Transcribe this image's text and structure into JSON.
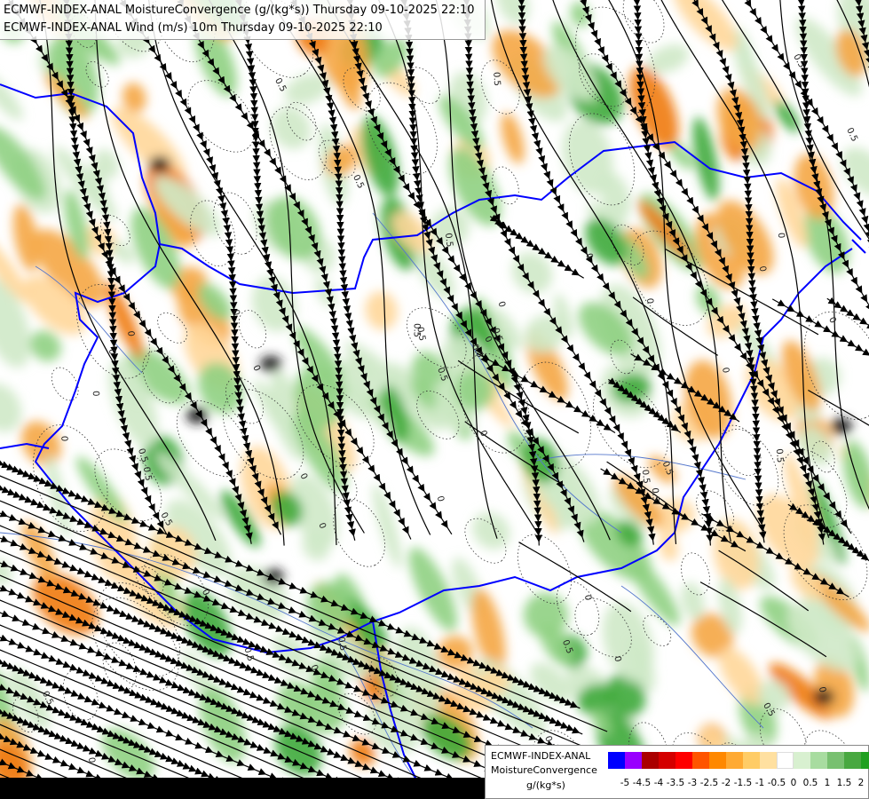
{
  "titles": {
    "line1": "ECMWF-INDEX-ANAL MoistureConvergence (g/(kg*s)) Thursday 09-10-2025 22:10",
    "line2": "ECMWF-INDEX-ANAL Wind (m/s) 10m Thursday 09-10-2025 22:10"
  },
  "legend": {
    "title1": "ECMWF-INDEX-ANAL",
    "title2": "MoistureConvergence",
    "unit": "g/(kg*s)",
    "colors": [
      "#0000ff",
      "#9900ff",
      "#aa0000",
      "#d40000",
      "#ff0000",
      "#ff5500",
      "#ff8800",
      "#ffaa33",
      "#ffcc66",
      "#ffe0a0",
      "#ffffff",
      "#d8f0d0",
      "#a8dca0",
      "#78c070",
      "#48a840",
      "#20a020"
    ],
    "ticks": [
      "-5",
      "-4.5",
      "-4",
      "-3.5",
      "-3",
      "-2.5",
      "-2",
      "-1.5",
      "-1",
      "-0.5",
      "0",
      "0.5",
      "1",
      "1.5",
      "2"
    ]
  },
  "map": {
    "contour_labels": [
      "0",
      "0.5",
      "-0.5"
    ],
    "colors": {
      "border": "#0000ff",
      "river": "#5577cc",
      "streamline": "#000000",
      "convergence_light": "#cfe9c8",
      "convergence_mid": "#8fd082",
      "convergence_strong": "#3faa3a",
      "divergence_light": "#ffd79a",
      "divergence_mid": "#f5a642",
      "divergence_strong": "#f07a10"
    }
  }
}
